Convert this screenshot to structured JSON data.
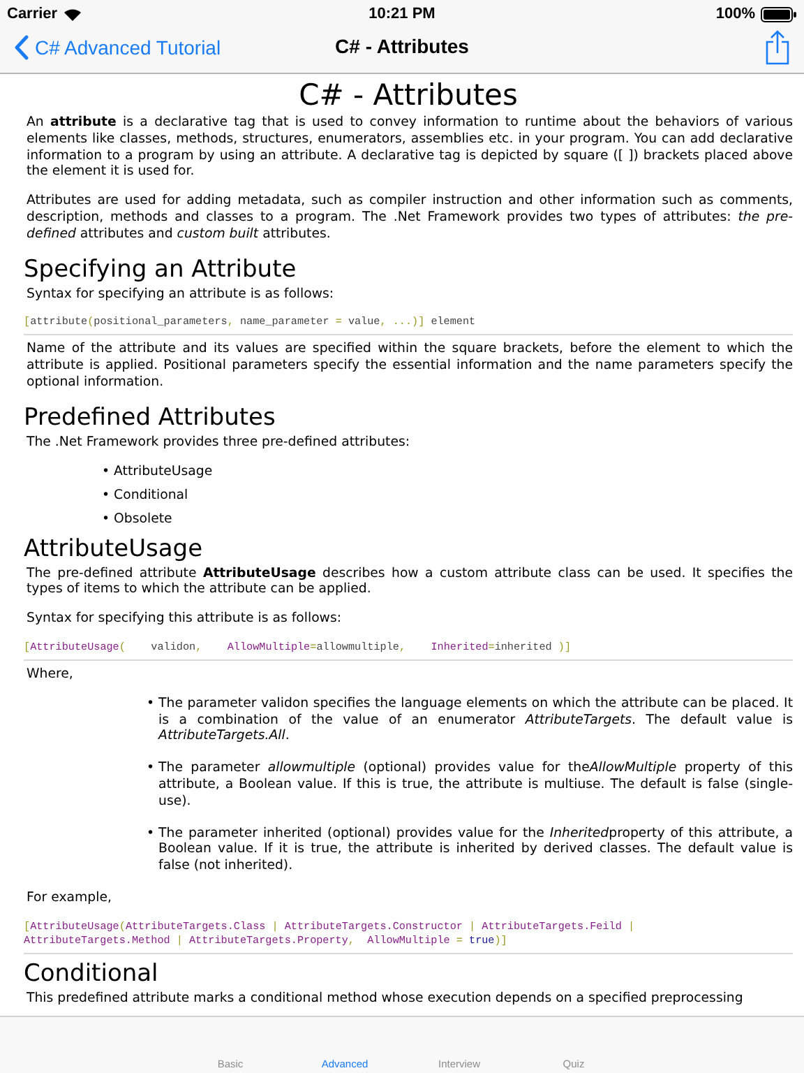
{
  "status_bar": {
    "carrier": "Carrier",
    "time": "10:21 PM",
    "battery": "100%"
  },
  "nav": {
    "back": "C# Advanced Tutorial",
    "title": "C# - Attributes"
  },
  "article": {
    "title": "C# - Attributes",
    "blocks": [
      {
        "kind": "paragraph",
        "text": "An **attribute** is a declarative tag that is used to convey information to runtime about the behaviors of various elements like classes, methods, structures, enumerators, assemblies etc. in your program. You can add declarative information to a program by using an attribute. A declarative tag is depicted by square ([ ]) brackets placed above the element it is used for."
      },
      {
        "kind": "paragraph",
        "text": "Attributes are used for adding metadata, such as compiler instruction and other information such as comments, description, methods and classes to a program. The .Net Framework provides two types of attributes: *the pre-defined* attributes and *custom built* attributes."
      },
      {
        "kind": "heading",
        "text": "Specifying an Attribute"
      },
      {
        "kind": "paragraph",
        "text": "Syntax for specifying an attribute is as follows:"
      },
      {
        "kind": "code",
        "lines": [
          [
            {
              "kind": "punct",
              "text": "["
            },
            {
              "kind": "plain",
              "text": "attribute"
            },
            {
              "kind": "punct",
              "text": "("
            },
            {
              "kind": "plain",
              "text": "positional_parameters"
            },
            {
              "kind": "punct",
              "text": ","
            },
            {
              "kind": "plain",
              "text": " name_parameter "
            },
            {
              "kind": "punct",
              "text": "="
            },
            {
              "kind": "plain",
              "text": " value"
            },
            {
              "kind": "punct",
              "text": ", ...)]"
            },
            {
              "kind": "plain",
              "text": " element"
            }
          ]
        ]
      },
      {
        "kind": "paragraph",
        "text": "Name of the attribute and its values are specified within the square brackets, before the element to which the attribute is applied. Positional parameters specify the essential information and the name parameters specify the optional information."
      },
      {
        "kind": "heading",
        "text": "Predefined Attributes"
      },
      {
        "kind": "paragraph",
        "text": "The .Net Framework provides three pre-defined attributes:"
      },
      {
        "kind": "list",
        "items": [
          {
            "bullet": "•",
            "text": "AttributeUsage"
          },
          {
            "bullet": "•",
            "text": "Conditional"
          },
          {
            "bullet": "•",
            "text": "Obsolete"
          }
        ]
      },
      {
        "kind": "heading",
        "text": "AttributeUsage"
      },
      {
        "kind": "paragraph",
        "text": "The pre-defined attribute **AttributeUsage** describes how a custom attribute class can be used. It specifies the types of items to which the attribute can be applied."
      },
      {
        "kind": "paragraph",
        "text": "Syntax for specifying this attribute is as follows:"
      },
      {
        "kind": "code",
        "lines": [
          [
            {
              "kind": "punct",
              "text": "["
            },
            {
              "kind": "type",
              "text": "AttributeUsage"
            },
            {
              "kind": "punct",
              "text": "("
            },
            {
              "kind": "plain",
              "text": "    validon"
            },
            {
              "kind": "punct",
              "text": ",    "
            },
            {
              "kind": "type",
              "text": "AllowMultiple"
            },
            {
              "kind": "punct",
              "text": "="
            },
            {
              "kind": "plain",
              "text": "allowmultiple"
            },
            {
              "kind": "punct",
              "text": ",    "
            },
            {
              "kind": "type",
              "text": "Inherited"
            },
            {
              "kind": "punct",
              "text": "="
            },
            {
              "kind": "plain",
              "text": "inherited "
            },
            {
              "kind": "punct",
              "text": ")]"
            }
          ]
        ]
      },
      {
        "kind": "paragraph",
        "text": "Where,"
      },
      {
        "kind": "notes",
        "items": [
          {
            "bullet": "•",
            "segments": [
              {
                "kind": "plain",
                "text": "The parameter validon specifies the language elements on which the attribute can be placed. It is a combination of the value of an enumerator "
              },
              {
                "kind": "em",
                "text": "AttributeTargets"
              },
              {
                "kind": "plain",
                "text": ". The default value is "
              },
              {
                "kind": "em",
                "text": "AttributeTargets.All"
              },
              {
                "kind": "plain",
                "text": "."
              }
            ]
          },
          {
            "bullet": "•",
            "segments": [
              {
                "kind": "plain",
                "text": "The parameter "
              },
              {
                "kind": "em",
                "text": "allowmultiple"
              },
              {
                "kind": "plain",
                "text": " (optional) provides value for the"
              },
              {
                "kind": "em",
                "text": "AllowMultiple"
              },
              {
                "kind": "plain",
                "text": " property of this attribute, a Boolean value. If this is true, the attribute is multiuse. The default is false (single-use)."
              }
            ]
          },
          {
            "bullet": "•",
            "segments": [
              {
                "kind": "plain",
                "text": "The parameter inherited (optional) provides value for the "
              },
              {
                "kind": "em",
                "text": "Inherited"
              },
              {
                "kind": "plain",
                "text": "property of this attribute, a Boolean value. If it is true, the attribute is inherited by derived classes. The default value is false (not inherited)."
              }
            ]
          }
        ]
      },
      {
        "kind": "paragraph",
        "text": "For example,"
      },
      {
        "kind": "code",
        "lines": [
          [
            {
              "kind": "punct",
              "text": "["
            },
            {
              "kind": "type",
              "text": "AttributeUsage"
            },
            {
              "kind": "punct",
              "text": "("
            },
            {
              "kind": "type",
              "text": "AttributeTargets.Class"
            },
            {
              "kind": "punct",
              "text": " | "
            },
            {
              "kind": "type",
              "text": "AttributeTargets.Constructor"
            },
            {
              "kind": "punct",
              "text": " | "
            },
            {
              "kind": "type",
              "text": "AttributeTargets.Feild"
            },
            {
              "kind": "punct",
              "text": " |"
            }
          ],
          [
            {
              "kind": "type",
              "text": "AttributeTargets.Method"
            },
            {
              "kind": "punct",
              "text": " | "
            },
            {
              "kind": "type",
              "text": "AttributeTargets.Property"
            },
            {
              "kind": "punct",
              "text": ",  "
            },
            {
              "kind": "type",
              "text": "AllowMultiple"
            },
            {
              "kind": "punct",
              "text": " = "
            },
            {
              "kind": "keyword",
              "text": "true"
            },
            {
              "kind": "punct",
              "text": ")]"
            }
          ]
        ]
      },
      {
        "kind": "heading",
        "text": "Conditional"
      },
      {
        "kind": "paragraph",
        "text": "This predefined attribute marks a conditional method whose execution depends on a specified preprocessing"
      }
    ]
  },
  "tab_bar": [
    {
      "label": "Basic",
      "selected": false
    },
    {
      "label": "Advanced",
      "selected": true
    },
    {
      "label": "Interview",
      "selected": false
    },
    {
      "label": "Quiz",
      "selected": false
    }
  ]
}
